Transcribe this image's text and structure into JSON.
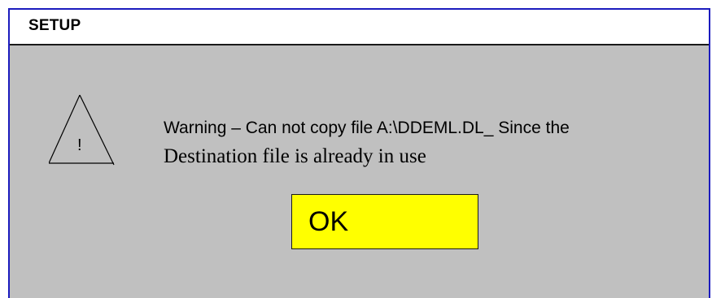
{
  "dialog": {
    "title": "SETUP",
    "icon": "warning-triangle-icon",
    "icon_glyph": "!",
    "message_line1": "Warning – Can not copy file A:\\DDEML.DL_ Since the",
    "message_line2": "Destination file is already in use",
    "ok_label": "OK"
  },
  "colors": {
    "dialog_border": "#1c1cbe",
    "dialog_background": "#c0c0c0",
    "titlebar_background": "#ffffff",
    "ok_button_background": "#ffff00"
  }
}
